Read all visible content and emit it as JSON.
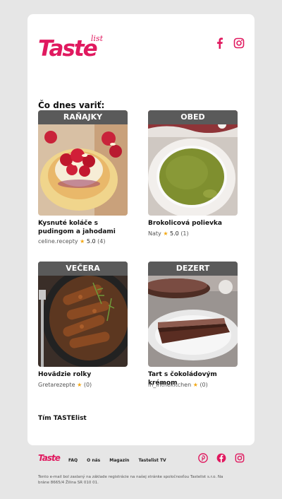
{
  "brand": {
    "logo_main": "Taste",
    "logo_sub": "list",
    "color": "#e0195f"
  },
  "header": {
    "social": [
      "facebook-icon",
      "instagram-icon"
    ]
  },
  "headline": "Čo dnes variť:",
  "tiles": [
    {
      "category": "RAŇAJKY",
      "title": "Kysnuté koláče s pudingom a jahodami",
      "author": "celine.recepty",
      "star": "★",
      "rating": "5.0",
      "count": "(4)"
    },
    {
      "category": "OBED",
      "title": "Brokolicová polievka",
      "author": "Naty",
      "star": "★",
      "rating": "5.0",
      "count": "(1)"
    },
    {
      "category": "VEČERA",
      "title": "Hovädzie rolky",
      "author": "Gretarezepte",
      "star": "★",
      "rating": "",
      "count": "(0)"
    },
    {
      "category": "DEZERT",
      "title": "Tart s čokoládovým krémom",
      "author": "in_inthekitchen",
      "star": "★",
      "rating": "",
      "count": "(0)"
    }
  ],
  "signature": "Tím TASTElist",
  "footer": {
    "logo": "Taste",
    "nav": [
      "FAQ",
      "O nás",
      "Magazín",
      "Tastelist TV"
    ],
    "social": [
      "pinterest-icon",
      "facebook-icon",
      "instagram-icon"
    ],
    "legal": "Tento e-mail bol zaslaný na základe registrácie na našej stránke spoločnosťou Tastelist s.r.o. Na bráne 8665/4 Žilina SR 010 01."
  }
}
